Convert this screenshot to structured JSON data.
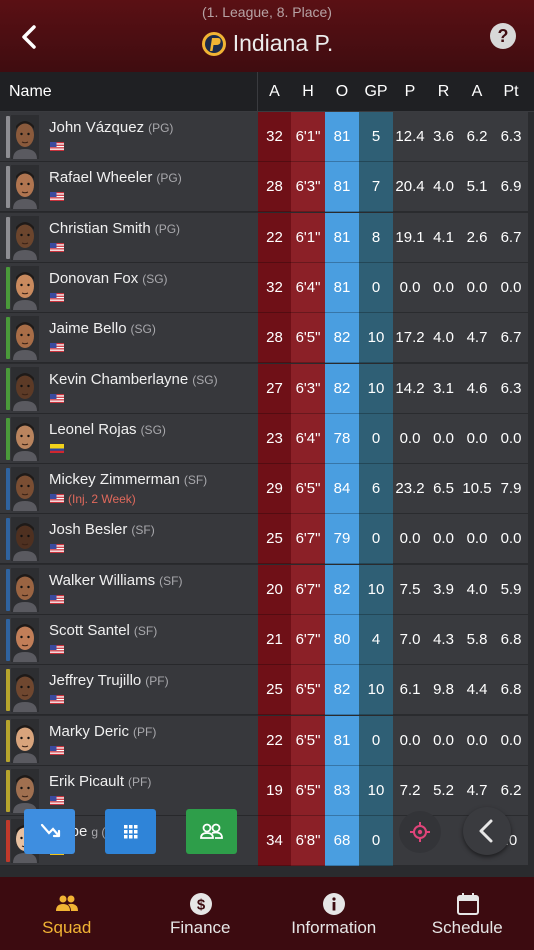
{
  "header": {
    "subtitle": "(1. League, 8. Place)",
    "title": "Indiana P."
  },
  "columns": {
    "name": "Name",
    "age": "A",
    "height": "H",
    "overall": "O",
    "gp": "GP",
    "points": "P",
    "rebounds": "R",
    "assists": "A",
    "pt": "Pt"
  },
  "players": [
    {
      "name": "John Vázquez",
      "pos": "(PG)",
      "age": "32",
      "height": "6'1\"",
      "ovr": "81",
      "gp": "5",
      "p": "12.4",
      "r": "3.6",
      "a": "6.2",
      "pt": "6.3",
      "flag": "us",
      "note": ""
    },
    {
      "name": "Rafael Wheeler",
      "pos": "(PG)",
      "age": "28",
      "height": "6'3\"",
      "ovr": "81",
      "gp": "7",
      "p": "20.4",
      "r": "4.0",
      "a": "5.1",
      "pt": "6.9",
      "flag": "us",
      "note": ""
    },
    {
      "name": "Christian Smith",
      "pos": "(PG)",
      "age": "22",
      "height": "6'1\"",
      "ovr": "81",
      "gp": "8",
      "p": "19.1",
      "r": "4.1",
      "a": "2.6",
      "pt": "6.7",
      "flag": "us",
      "note": ""
    },
    {
      "name": "Donovan Fox",
      "pos": "(SG)",
      "age": "32",
      "height": "6'4\"",
      "ovr": "81",
      "gp": "0",
      "p": "0.0",
      "r": "0.0",
      "a": "0.0",
      "pt": "0.0",
      "flag": "us",
      "note": ""
    },
    {
      "name": "Jaime Bello",
      "pos": "(SG)",
      "age": "28",
      "height": "6'5\"",
      "ovr": "82",
      "gp": "10",
      "p": "17.2",
      "r": "4.0",
      "a": "4.7",
      "pt": "6.7",
      "flag": "us",
      "note": ""
    },
    {
      "name": "Kevin Chamberlayne",
      "pos": "(SG)",
      "age": "27",
      "height": "6'3\"",
      "ovr": "82",
      "gp": "10",
      "p": "14.2",
      "r": "3.1",
      "a": "4.6",
      "pt": "6.3",
      "flag": "us",
      "note": ""
    },
    {
      "name": "Leonel Rojas",
      "pos": "(SG)",
      "age": "23",
      "height": "6'4\"",
      "ovr": "78",
      "gp": "0",
      "p": "0.0",
      "r": "0.0",
      "a": "0.0",
      "pt": "0.0",
      "flag": "ec",
      "note": ""
    },
    {
      "name": "Mickey Zimmerman",
      "pos": "(SF)",
      "age": "29",
      "height": "6'5\"",
      "ovr": "84",
      "gp": "6",
      "p": "23.2",
      "r": "6.5",
      "a": "10.5",
      "pt": "7.9",
      "flag": "us",
      "note": "(Inj. 2 Week)"
    },
    {
      "name": "Josh Besler",
      "pos": "(SF)",
      "age": "25",
      "height": "6'7\"",
      "ovr": "79",
      "gp": "0",
      "p": "0.0",
      "r": "0.0",
      "a": "0.0",
      "pt": "0.0",
      "flag": "us",
      "note": ""
    },
    {
      "name": "Walker Williams",
      "pos": "(SF)",
      "age": "20",
      "height": "6'7\"",
      "ovr": "82",
      "gp": "10",
      "p": "7.5",
      "r": "3.9",
      "a": "4.0",
      "pt": "5.9",
      "flag": "us",
      "note": ""
    },
    {
      "name": "Scott Santel",
      "pos": "(SF)",
      "age": "21",
      "height": "6'7\"",
      "ovr": "80",
      "gp": "4",
      "p": "7.0",
      "r": "4.3",
      "a": "5.8",
      "pt": "6.8",
      "flag": "us",
      "note": ""
    },
    {
      "name": "Jeffrey Trujillo",
      "pos": "(PF)",
      "age": "25",
      "height": "6'5\"",
      "ovr": "82",
      "gp": "10",
      "p": "6.1",
      "r": "9.8",
      "a": "4.4",
      "pt": "6.8",
      "flag": "us",
      "note": ""
    },
    {
      "name": "Marky Deric",
      "pos": "(PF)",
      "age": "22",
      "height": "6'5\"",
      "ovr": "81",
      "gp": "0",
      "p": "0.0",
      "r": "0.0",
      "a": "0.0",
      "pt": "0.0",
      "flag": "us",
      "note": ""
    },
    {
      "name": "Erik Picault",
      "pos": "(PF)",
      "age": "19",
      "height": "6'5\"",
      "ovr": "83",
      "gp": "10",
      "p": "7.2",
      "r": "5.2",
      "a": "4.7",
      "pt": "6.2",
      "flag": "us",
      "note": ""
    },
    {
      "name": "berbe",
      "pos": "g (C)",
      "age": "34",
      "height": "6'8\"",
      "ovr": "68",
      "gp": "0",
      "p": "0",
      "r": "",
      "a": "",
      "pt": ".0",
      "flag": "de",
      "note": ""
    }
  ],
  "tabs": [
    {
      "label": "Squad",
      "icon": "people-icon",
      "active": true
    },
    {
      "label": "Finance",
      "icon": "dollar-icon",
      "active": false
    },
    {
      "label": "Information",
      "icon": "info-icon",
      "active": false
    },
    {
      "label": "Schedule",
      "icon": "calendar-icon",
      "active": false
    }
  ],
  "colors": {
    "header": "#4a0e12",
    "accent": "#f2b434",
    "ovr": "#4a9ee0",
    "age": "#6f1017",
    "height": "#8b2027",
    "gp": "#2f5f75",
    "pg": "#8e8e93",
    "sg": "#4a9a3a",
    "sf": "#2f63a0",
    "pf": "#b7a52d",
    "c": "#c0392b"
  }
}
